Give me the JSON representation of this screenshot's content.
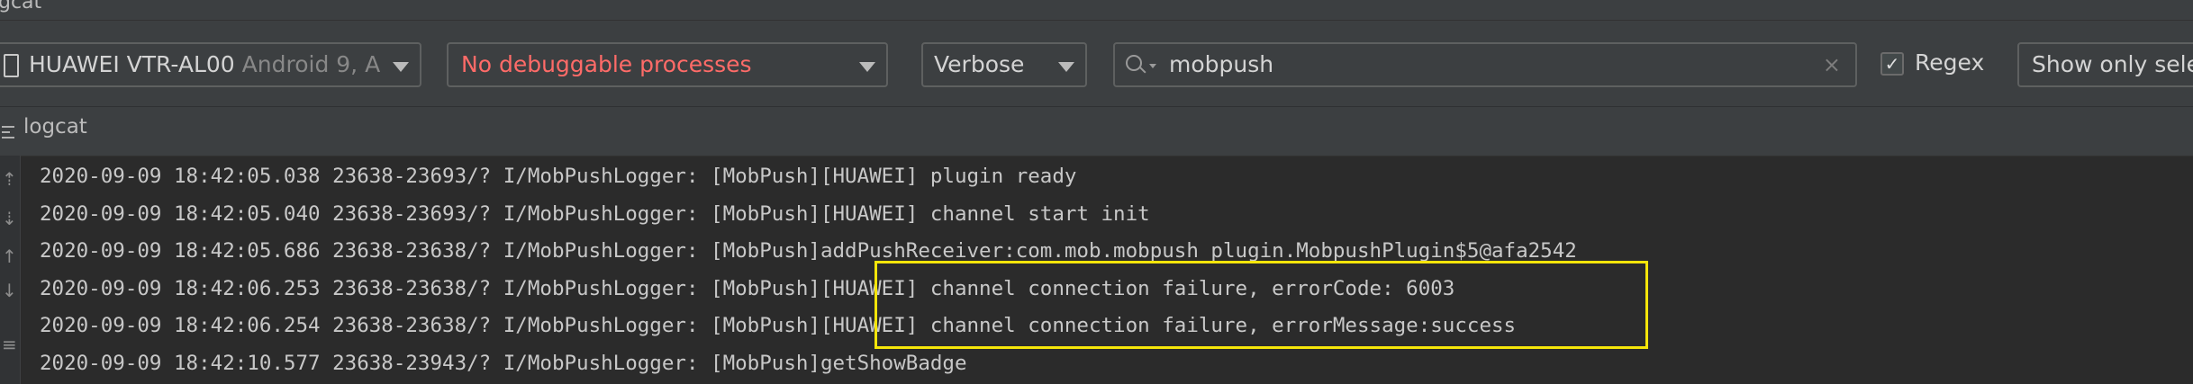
{
  "window": {
    "title_fragment": "gcat"
  },
  "toolbar": {
    "device": {
      "name": "HUAWEI VTR-AL00",
      "detail": "Android 9, A"
    },
    "process": {
      "label": "No debuggable processes"
    },
    "log_level": {
      "label": "Verbose"
    },
    "search": {
      "value": "mobpush",
      "clear": "×"
    },
    "regex": {
      "checked": true,
      "check_glyph": "✓",
      "label": "Regex"
    },
    "filter": {
      "label": "Show only sele"
    }
  },
  "panel": {
    "title": "logcat"
  },
  "logs": [
    "2020-09-09 18:42:05.038 23638-23693/? I/MobPushLogger: [MobPush][HUAWEI] plugin ready",
    "2020-09-09 18:42:05.040 23638-23693/? I/MobPushLogger: [MobPush][HUAWEI] channel start init",
    "2020-09-09 18:42:05.686 23638-23638/? I/MobPushLogger: [MobPush]addPushReceiver:com.mob.mobpush_plugin.MobpushPlugin$5@afa2542",
    "2020-09-09 18:42:06.253 23638-23638/? I/MobPushLogger: [MobPush][HUAWEI] channel connection failure, errorCode: 6003",
    "2020-09-09 18:42:06.254 23638-23638/? I/MobPushLogger: [MobPush][HUAWEI] channel connection failure, errorMessage:success",
    "2020-09-09 18:42:10.577 23638-23943/? I/MobPushLogger: [MobPush]getShowBadge"
  ],
  "colors": {
    "error_text": "#ff6b68",
    "highlight_box": "#f5e50a",
    "background": "#2b2b2b"
  }
}
